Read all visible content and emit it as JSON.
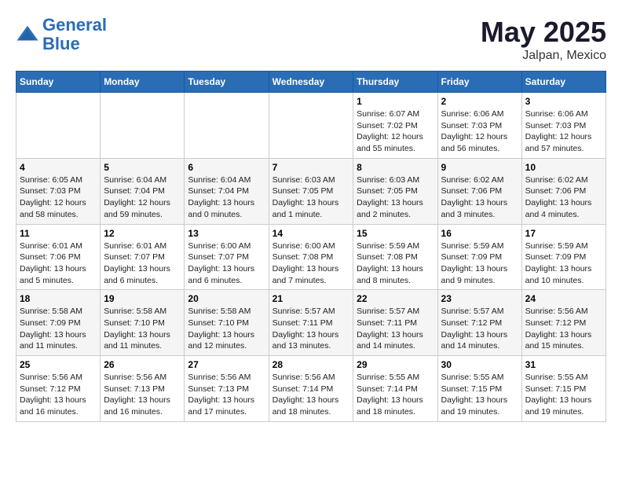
{
  "logo": {
    "line1": "General",
    "line2": "Blue"
  },
  "title": "May 2025",
  "location": "Jalpan, Mexico",
  "days_of_week": [
    "Sunday",
    "Monday",
    "Tuesday",
    "Wednesday",
    "Thursday",
    "Friday",
    "Saturday"
  ],
  "weeks": [
    [
      {
        "day": "",
        "info": ""
      },
      {
        "day": "",
        "info": ""
      },
      {
        "day": "",
        "info": ""
      },
      {
        "day": "",
        "info": ""
      },
      {
        "day": "1",
        "info": "Sunrise: 6:07 AM\nSunset: 7:02 PM\nDaylight: 12 hours\nand 55 minutes."
      },
      {
        "day": "2",
        "info": "Sunrise: 6:06 AM\nSunset: 7:03 PM\nDaylight: 12 hours\nand 56 minutes."
      },
      {
        "day": "3",
        "info": "Sunrise: 6:06 AM\nSunset: 7:03 PM\nDaylight: 12 hours\nand 57 minutes."
      }
    ],
    [
      {
        "day": "4",
        "info": "Sunrise: 6:05 AM\nSunset: 7:03 PM\nDaylight: 12 hours\nand 58 minutes."
      },
      {
        "day": "5",
        "info": "Sunrise: 6:04 AM\nSunset: 7:04 PM\nDaylight: 12 hours\nand 59 minutes."
      },
      {
        "day": "6",
        "info": "Sunrise: 6:04 AM\nSunset: 7:04 PM\nDaylight: 13 hours\nand 0 minutes."
      },
      {
        "day": "7",
        "info": "Sunrise: 6:03 AM\nSunset: 7:05 PM\nDaylight: 13 hours\nand 1 minute."
      },
      {
        "day": "8",
        "info": "Sunrise: 6:03 AM\nSunset: 7:05 PM\nDaylight: 13 hours\nand 2 minutes."
      },
      {
        "day": "9",
        "info": "Sunrise: 6:02 AM\nSunset: 7:06 PM\nDaylight: 13 hours\nand 3 minutes."
      },
      {
        "day": "10",
        "info": "Sunrise: 6:02 AM\nSunset: 7:06 PM\nDaylight: 13 hours\nand 4 minutes."
      }
    ],
    [
      {
        "day": "11",
        "info": "Sunrise: 6:01 AM\nSunset: 7:06 PM\nDaylight: 13 hours\nand 5 minutes."
      },
      {
        "day": "12",
        "info": "Sunrise: 6:01 AM\nSunset: 7:07 PM\nDaylight: 13 hours\nand 6 minutes."
      },
      {
        "day": "13",
        "info": "Sunrise: 6:00 AM\nSunset: 7:07 PM\nDaylight: 13 hours\nand 6 minutes."
      },
      {
        "day": "14",
        "info": "Sunrise: 6:00 AM\nSunset: 7:08 PM\nDaylight: 13 hours\nand 7 minutes."
      },
      {
        "day": "15",
        "info": "Sunrise: 5:59 AM\nSunset: 7:08 PM\nDaylight: 13 hours\nand 8 minutes."
      },
      {
        "day": "16",
        "info": "Sunrise: 5:59 AM\nSunset: 7:09 PM\nDaylight: 13 hours\nand 9 minutes."
      },
      {
        "day": "17",
        "info": "Sunrise: 5:59 AM\nSunset: 7:09 PM\nDaylight: 13 hours\nand 10 minutes."
      }
    ],
    [
      {
        "day": "18",
        "info": "Sunrise: 5:58 AM\nSunset: 7:09 PM\nDaylight: 13 hours\nand 11 minutes."
      },
      {
        "day": "19",
        "info": "Sunrise: 5:58 AM\nSunset: 7:10 PM\nDaylight: 13 hours\nand 11 minutes."
      },
      {
        "day": "20",
        "info": "Sunrise: 5:58 AM\nSunset: 7:10 PM\nDaylight: 13 hours\nand 12 minutes."
      },
      {
        "day": "21",
        "info": "Sunrise: 5:57 AM\nSunset: 7:11 PM\nDaylight: 13 hours\nand 13 minutes."
      },
      {
        "day": "22",
        "info": "Sunrise: 5:57 AM\nSunset: 7:11 PM\nDaylight: 13 hours\nand 14 minutes."
      },
      {
        "day": "23",
        "info": "Sunrise: 5:57 AM\nSunset: 7:12 PM\nDaylight: 13 hours\nand 14 minutes."
      },
      {
        "day": "24",
        "info": "Sunrise: 5:56 AM\nSunset: 7:12 PM\nDaylight: 13 hours\nand 15 minutes."
      }
    ],
    [
      {
        "day": "25",
        "info": "Sunrise: 5:56 AM\nSunset: 7:12 PM\nDaylight: 13 hours\nand 16 minutes."
      },
      {
        "day": "26",
        "info": "Sunrise: 5:56 AM\nSunset: 7:13 PM\nDaylight: 13 hours\nand 16 minutes."
      },
      {
        "day": "27",
        "info": "Sunrise: 5:56 AM\nSunset: 7:13 PM\nDaylight: 13 hours\nand 17 minutes."
      },
      {
        "day": "28",
        "info": "Sunrise: 5:56 AM\nSunset: 7:14 PM\nDaylight: 13 hours\nand 18 minutes."
      },
      {
        "day": "29",
        "info": "Sunrise: 5:55 AM\nSunset: 7:14 PM\nDaylight: 13 hours\nand 18 minutes."
      },
      {
        "day": "30",
        "info": "Sunrise: 5:55 AM\nSunset: 7:15 PM\nDaylight: 13 hours\nand 19 minutes."
      },
      {
        "day": "31",
        "info": "Sunrise: 5:55 AM\nSunset: 7:15 PM\nDaylight: 13 hours\nand 19 minutes."
      }
    ]
  ]
}
